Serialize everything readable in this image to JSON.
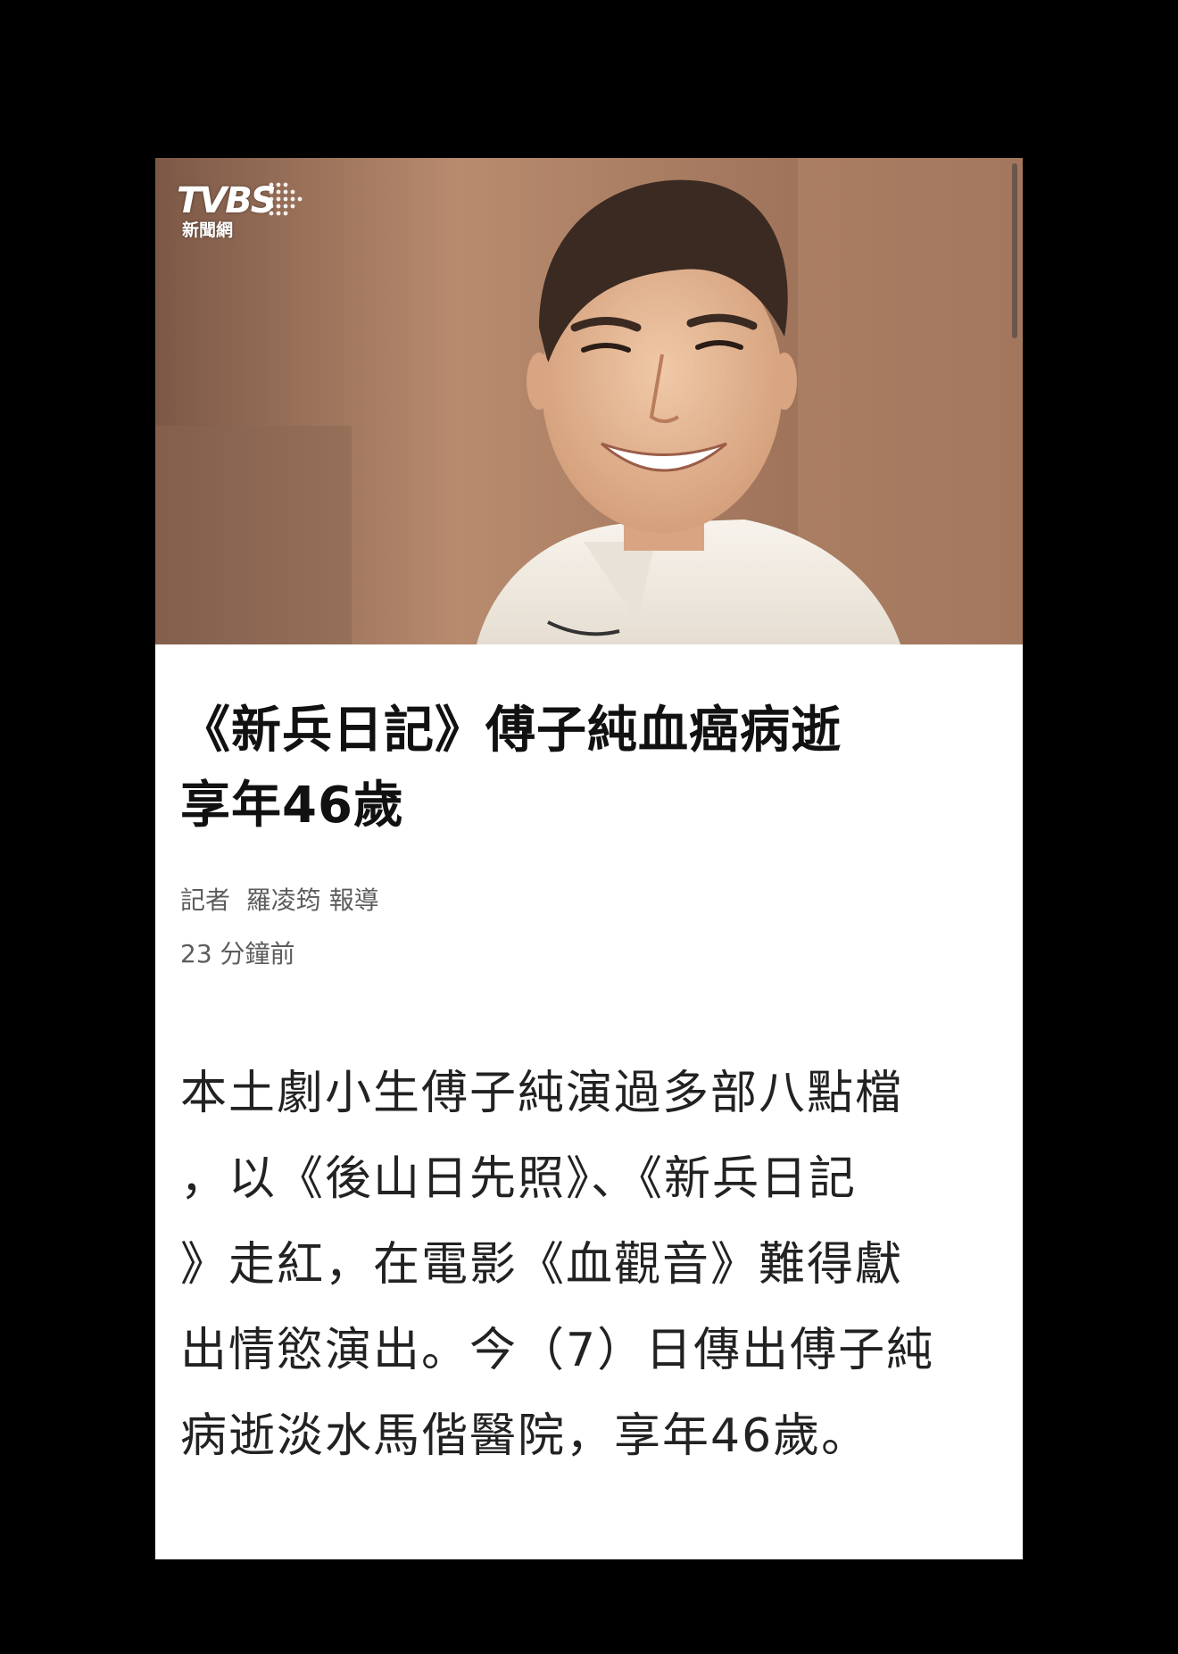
{
  "source": {
    "logo_text": "TVBS",
    "logo_subtext": "新聞網"
  },
  "article": {
    "headline_line1": "《新兵日記》傅子純血癌病逝",
    "headline_line2": "享年46歲",
    "byline": "記者  羅凌筠 報導",
    "timestamp": "23 分鐘前",
    "body": "本土劇小生傅子純演過多部八點檔\n，以《後山日先照》、《新兵日記\n》走紅，在電影《血觀音》難得獻\n出情慾演出。今（7）日傳出傅子純\n病逝淡水馬偕醫院，享年46歲。"
  },
  "colors": {
    "page_background": "#000000",
    "card_background": "#ffffff",
    "headline": "#111111",
    "meta_text": "#5c5c5c",
    "body_text": "#222222"
  }
}
